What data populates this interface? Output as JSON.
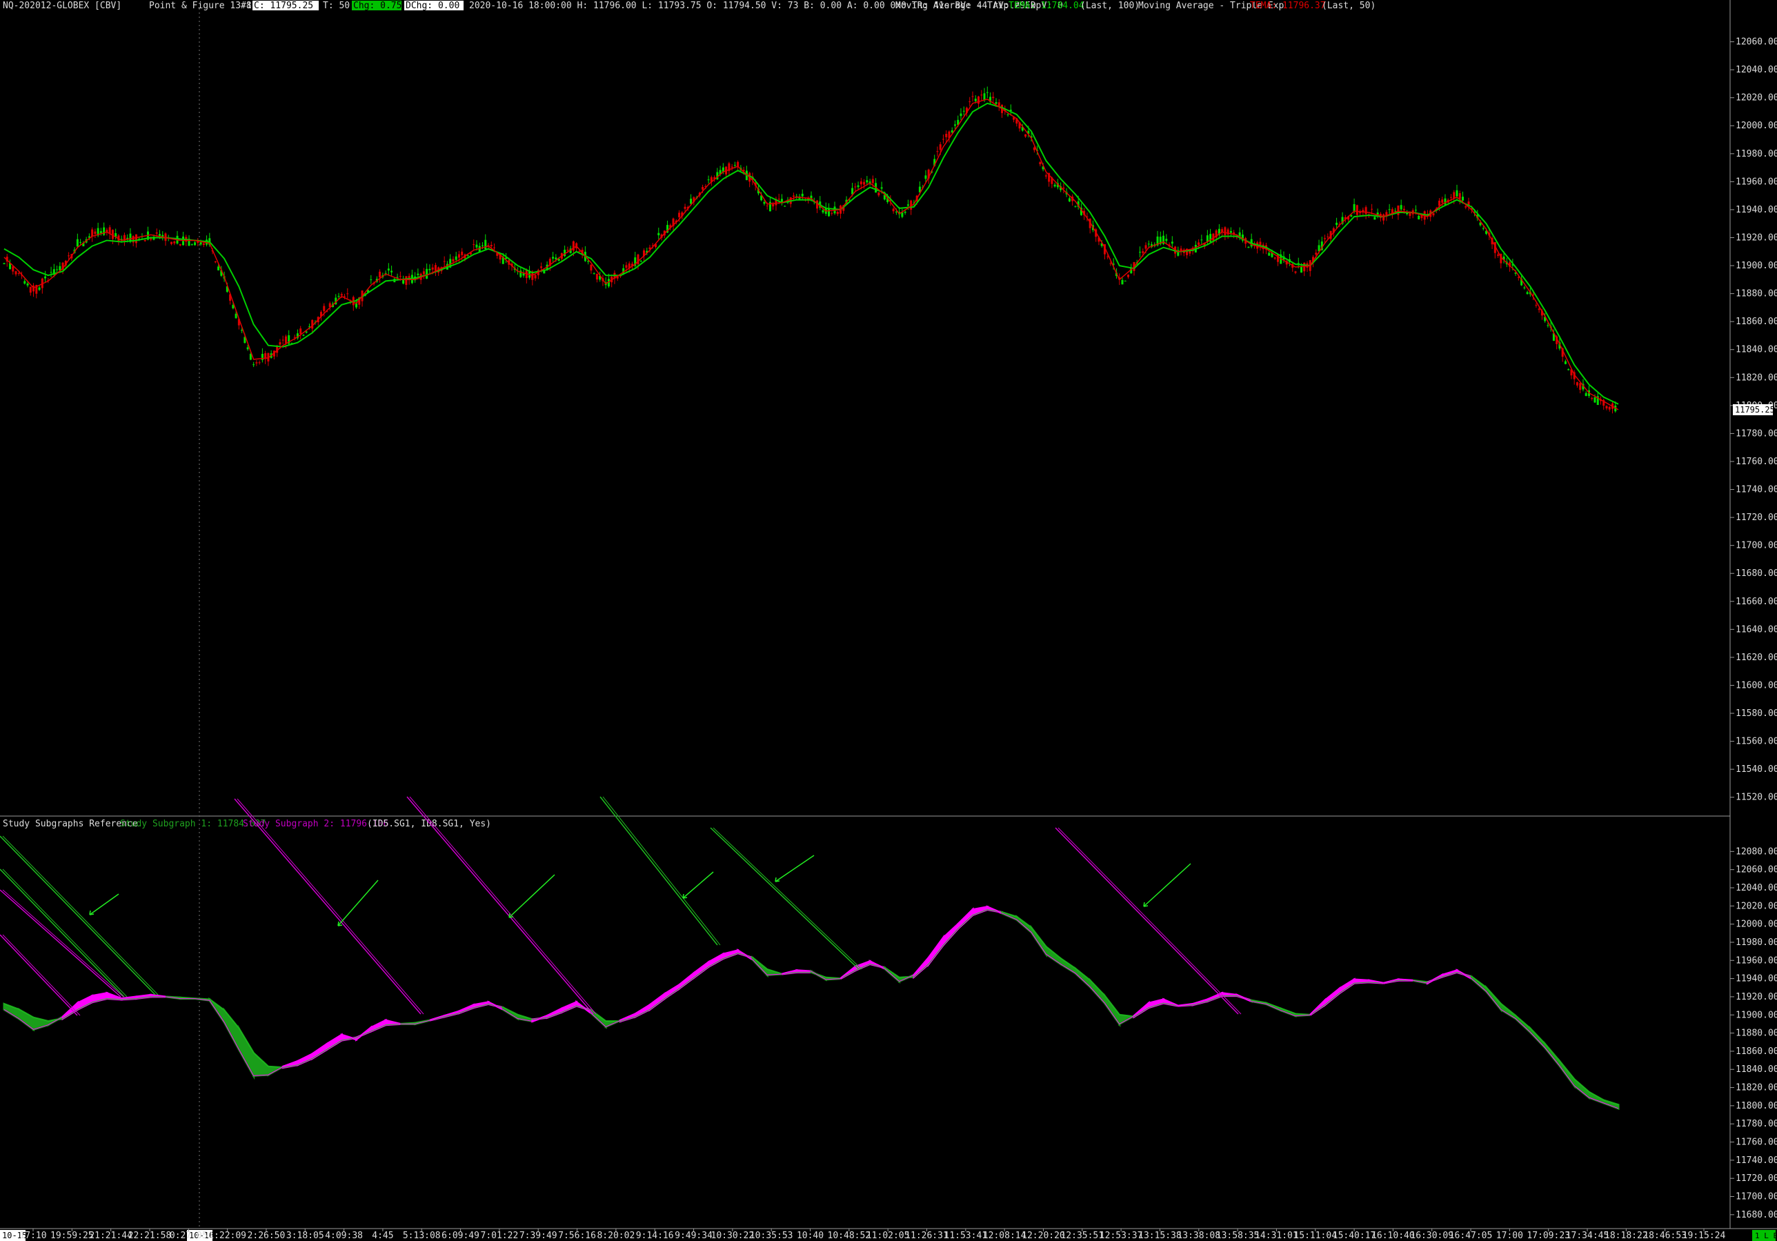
{
  "header": {
    "symbol": "NQ-202012-GLOBEX [CBV]",
    "chart_type": "Point & Figure 13-1",
    "bar_no": "#8",
    "close_label": "C: 11795.25",
    "ticks_label": "T: 50",
    "chg_label": "Chg: 0.75",
    "dchg_label": "DChg: 0.00",
    "ohlc_info": "2020-10-16 18:00:00 H: 11796.00 L: 11793.75 O: 11794.50 V: 73 B: 0.00 A: 0.00 0x0 TR: 41s BV: 44 AV: 29 D V: 0",
    "ma1_name": "Moving Average - Triple Exp",
    "ma1_value": "TEMA: 11784.04",
    "ma1_params": "(Last, 100)",
    "ma2_name": "Moving Average - Triple Exp",
    "ma2_value": "TEMA: 11796.37",
    "ma2_params": "(Last, 50)"
  },
  "lower_header": {
    "study_name": "Study Subgraphs Reference",
    "sg1": "Study Subgraph 1: 11784.037",
    "sg2": "Study Subgraph 2: 11796.106",
    "params": "(ID5.SG1, ID8.SG1, Yes)"
  },
  "price_label": "11795.25",
  "colors": {
    "background": "#000000",
    "up_candle": "#00e000",
    "down_candle": "#e00000",
    "tema_100": "#00d000",
    "tema_50": "#e00000",
    "fill_up": "#ff00ff",
    "fill_down": "#1a9e1a",
    "diag_magenta": "#d000d0",
    "diag_green": "#1fbf1f",
    "text": "#dddddd"
  },
  "chart_data": [
    {
      "type": "line",
      "title": "",
      "ylim": [
        11510,
        12080
      ],
      "y_ticks": [
        11520,
        11540,
        11560,
        11580,
        11600,
        11620,
        11640,
        11660,
        11680,
        11700,
        11720,
        11740,
        11760,
        11780,
        11800,
        11820,
        11840,
        11860,
        11880,
        11900,
        11920,
        11940,
        11960,
        11980,
        12000,
        12020,
        12040,
        12060
      ],
      "y_tick_labels": [
        "11520.00",
        "11540.00",
        "11560.00",
        "11580.00",
        "11600.00",
        "11620.00",
        "11640.00",
        "11660.00",
        "11680.00",
        "11700.00",
        "11720.00",
        "11740.00",
        "11760.00",
        "11780.00",
        "11800.00",
        "11820.00",
        "11840.00",
        "11860.00",
        "11880.00",
        "11900.00",
        "11920.00",
        "11940.00",
        "11960.00",
        "11980.00",
        "12000.00",
        "12020.00",
        "12040.00",
        "12060.00"
      ],
      "x_count": 111,
      "price": [
        11905,
        11895,
        11882,
        11890,
        11900,
        11915,
        11922,
        11925,
        11918,
        11920,
        11922,
        11920,
        11918,
        11918,
        11916,
        11890,
        11860,
        11830,
        11835,
        11845,
        11850,
        11858,
        11870,
        11880,
        11872,
        11888,
        11895,
        11890,
        11890,
        11895,
        11900,
        11905,
        11912,
        11915,
        11905,
        11895,
        11892,
        11900,
        11908,
        11915,
        11900,
        11885,
        11895,
        11902,
        11912,
        11925,
        11935,
        11948,
        11960,
        11968,
        11972,
        11960,
        11942,
        11945,
        11950,
        11948,
        11938,
        11940,
        11955,
        11960,
        11950,
        11935,
        11945,
        11965,
        11988,
        12002,
        12018,
        12020,
        12012,
        12005,
        11990,
        11965,
        11955,
        11945,
        11930,
        11912,
        11888,
        11900,
        11915,
        11918,
        11910,
        11912,
        11918,
        11925,
        11922,
        11915,
        11912,
        11905,
        11898,
        11900,
        11918,
        11930,
        11940,
        11938,
        11935,
        11940,
        11938,
        11935,
        11945,
        11950,
        11940,
        11925,
        11905,
        11895,
        11880,
        11862,
        11842,
        11820,
        11808,
        11802,
        11797
      ],
      "series": [
        {
          "name": "TEMA (Last, 100)",
          "values": [
            11912,
            11906,
            11897,
            11893,
            11896,
            11906,
            11914,
            11918,
            11917,
            11918,
            11920,
            11920,
            11919,
            11918,
            11917,
            11905,
            11885,
            11858,
            11843,
            11842,
            11845,
            11852,
            11862,
            11872,
            11875,
            11882,
            11889,
            11890,
            11891,
            11894,
            11898,
            11902,
            11908,
            11912,
            11908,
            11900,
            11895,
            11897,
            11903,
            11910,
            11905,
            11893,
            11893,
            11898,
            11906,
            11918,
            11929,
            11941,
            11953,
            11962,
            11968,
            11963,
            11950,
            11945,
            11947,
            11947,
            11941,
            11940,
            11949,
            11956,
            11952,
            11941,
            11942,
            11956,
            11977,
            11995,
            12010,
            12016,
            12013,
            12008,
            11996,
            11975,
            11962,
            11951,
            11938,
            11921,
            11900,
            11898,
            11908,
            11913,
            11910,
            11911,
            11915,
            11921,
            11921,
            11916,
            11913,
            11907,
            11901,
            11900,
            11911,
            11924,
            11935,
            11936,
            11935,
            11938,
            11938,
            11936,
            11942,
            11947,
            11942,
            11930,
            11912,
            11899,
            11885,
            11868,
            11849,
            11829,
            11815,
            11806,
            11801
          ]
        },
        {
          "name": "TEMA (Last, 50)",
          "values": [
            11906,
            11896,
            11884,
            11889,
            11898,
            11913,
            11921,
            11924,
            11918,
            11920,
            11922,
            11920,
            11918,
            11918,
            11916,
            11892,
            11862,
            11833,
            11834,
            11843,
            11849,
            11857,
            11868,
            11878,
            11873,
            11886,
            11894,
            11890,
            11890,
            11894,
            11899,
            11904,
            11911,
            11914,
            11906,
            11896,
            11893,
            11899,
            11907,
            11914,
            11902,
            11887,
            11894,
            11901,
            11911,
            11923,
            11933,
            11946,
            11958,
            11967,
            11971,
            11961,
            11944,
            11945,
            11949,
            11948,
            11939,
            11940,
            11953,
            11959,
            11951,
            11937,
            11944,
            11963,
            11985,
            12000,
            12016,
            12019,
            12012,
            12005,
            11991,
            11967,
            11956,
            11946,
            11931,
            11913,
            11890,
            11899,
            11913,
            11917,
            11910,
            11912,
            11917,
            11924,
            11922,
            11915,
            11912,
            11905,
            11899,
            11900,
            11916,
            11929,
            11939,
            11938,
            11935,
            11939,
            11938,
            11935,
            11944,
            11949,
            11940,
            11926,
            11906,
            11896,
            11881,
            11864,
            11844,
            11822,
            11809,
            11803,
            11797
          ]
        }
      ]
    },
    {
      "type": "area",
      "title": "",
      "ylim": [
        11670,
        12100
      ],
      "y_ticks": [
        11680,
        11700,
        11720,
        11740,
        11760,
        11780,
        11800,
        11820,
        11840,
        11860,
        11880,
        11900,
        11920,
        11940,
        11960,
        11980,
        12000,
        12020,
        12040,
        12060,
        12080
      ],
      "y_tick_labels": [
        "11680.00",
        "11700.00",
        "11720.00",
        "11740.00",
        "11760.00",
        "11780.00",
        "11800.00",
        "11820.00",
        "11840.00",
        "11860.00",
        "11880.00",
        "11900.00",
        "11920.00",
        "11940.00",
        "11960.00",
        "11980.00",
        "12000.00",
        "12020.00",
        "12040.00",
        "12060.00",
        "12080.00"
      ],
      "series": [
        {
          "name": "Study Subgraph 1"
        },
        {
          "name": "Study Subgraph 2"
        }
      ]
    }
  ],
  "time_axis": {
    "date_badge_left": "10-15",
    "date_badge_mid": "10-16",
    "right_badge": "1 L E",
    "labels": [
      "17:10",
      "19:59:25",
      "21:21:44",
      "22:21:58",
      "0:27:05",
      "1:22:09",
      "2:26:50",
      "3:18:05",
      "4:09:38",
      "4:45",
      "5:13:08",
      "6:09:49",
      "7:01:22",
      "7:39:49",
      "7:56:16",
      "8:20:02",
      "9:14:16",
      "9:49:34",
      "10:30:22",
      "10:35:53",
      "10:40",
      "10:48:52",
      "11:02:05",
      "11:26:31",
      "11:53:41",
      "12:08:14",
      "12:20:20",
      "12:35:51",
      "12:53:37",
      "13:15:38",
      "13:38:08",
      "13:58:35",
      "14:31:01",
      "15:11:04",
      "15:40:17",
      "16:10:40",
      "16:30:09",
      "16:47:05",
      "17:00",
      "17:09:23",
      "17:34:45",
      "18:18:22",
      "18:46:53",
      "19:15:24"
    ]
  }
}
